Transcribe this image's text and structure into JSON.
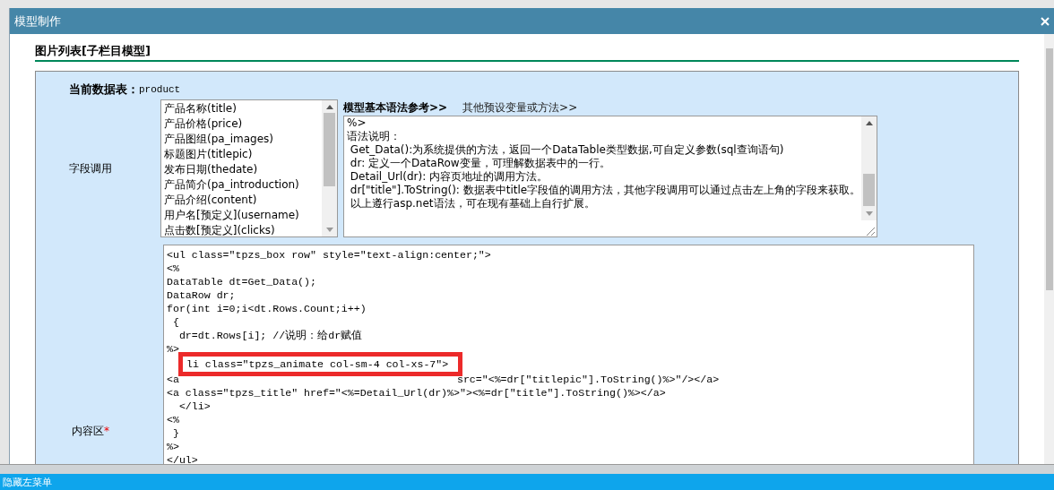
{
  "window": {
    "title": "模型制作"
  },
  "heading": "图片列表[子栏目模型]",
  "table_info": {
    "label": "当前数据表：",
    "value": "product"
  },
  "fields": {
    "label": "字段调用",
    "items": [
      {
        "name": "产品名称",
        "key": "(title)"
      },
      {
        "name": "产品价格",
        "key": "(price)"
      },
      {
        "name": "产品图组",
        "key": "(pa_images)"
      },
      {
        "name": "标题图片",
        "key": "(titlepic)"
      },
      {
        "name": "发布日期",
        "key": "(thedate)"
      },
      {
        "name": "产品简介",
        "key": "(pa_introduction)"
      },
      {
        "name": "产品介绍",
        "key": "(content)"
      },
      {
        "name": "用户名[预定义]",
        "key": "(username)"
      },
      {
        "name": "点击数[预定义]",
        "key": "(clicks)"
      }
    ]
  },
  "reference_tabs": [
    {
      "label": "模型基本语法参考>>",
      "selected": true
    },
    {
      "label": "其他预设变量或方法>>",
      "selected": false
    }
  ],
  "reference_text": [
    "%>",
    "语法说明：",
    " Get_Data():为系统提供的方法，返回一个DataTable类型数据,可自定义参数(sql查询语句)",
    " dr: 定义一个DataRow变量，可理解数据表中的一行。",
    " Detail_Url(dr): 内容页地址的调用方法。",
    " dr[\"title\"].ToString(): 数据表中title字段值的调用方法，其他字段调用可以通过点击左上角的字段来获取。",
    " 以上遵行asp.net语法，可在现有基础上自行扩展。"
  ],
  "content": {
    "label": "内容区",
    "required": true,
    "required_mark": "*",
    "lines": [
      {
        "kind": "plain",
        "text": "<ul class=\"tpzs_box row\" style=\"text-align:center;\">"
      },
      {
        "kind": "plain",
        "text": "<%"
      },
      {
        "kind": "plain",
        "text": "DataTable dt=Get_Data();"
      },
      {
        "kind": "plain",
        "text": "DataRow dr;"
      },
      {
        "kind": "plain",
        "text": "for(int i=0;i<dt.Rows.Count;i++)"
      },
      {
        "kind": "plain",
        "text": " {"
      },
      {
        "kind": "plain",
        "text": "  dr=dt.Rows[i]; //说明：给dr赋值"
      },
      {
        "kind": "plain",
        "text": "%>"
      },
      {
        "kind": "marked",
        "text": "li class=\"tpzs_animate col-sm-4 col-xs-7\">"
      },
      {
        "kind": "obscured",
        "segments": [
          "<a",
          "src=\"<%=dr[\"titlepic\"].ToString()%>\"/></a>"
        ]
      },
      {
        "kind": "plain",
        "text": "<a class=\"tpzs_title\" href=\"<%=Detail_Url(dr)%>\"><%=dr[\"title\"].ToString()%></a>"
      },
      {
        "kind": "plain",
        "text": "  </li>"
      },
      {
        "kind": "plain",
        "text": "<%"
      },
      {
        "kind": "plain",
        "text": " }"
      },
      {
        "kind": "plain",
        "text": "%>"
      },
      {
        "kind": "plain",
        "text": "</ul>"
      }
    ]
  },
  "footer": {
    "label": "隐藏左菜单"
  }
}
